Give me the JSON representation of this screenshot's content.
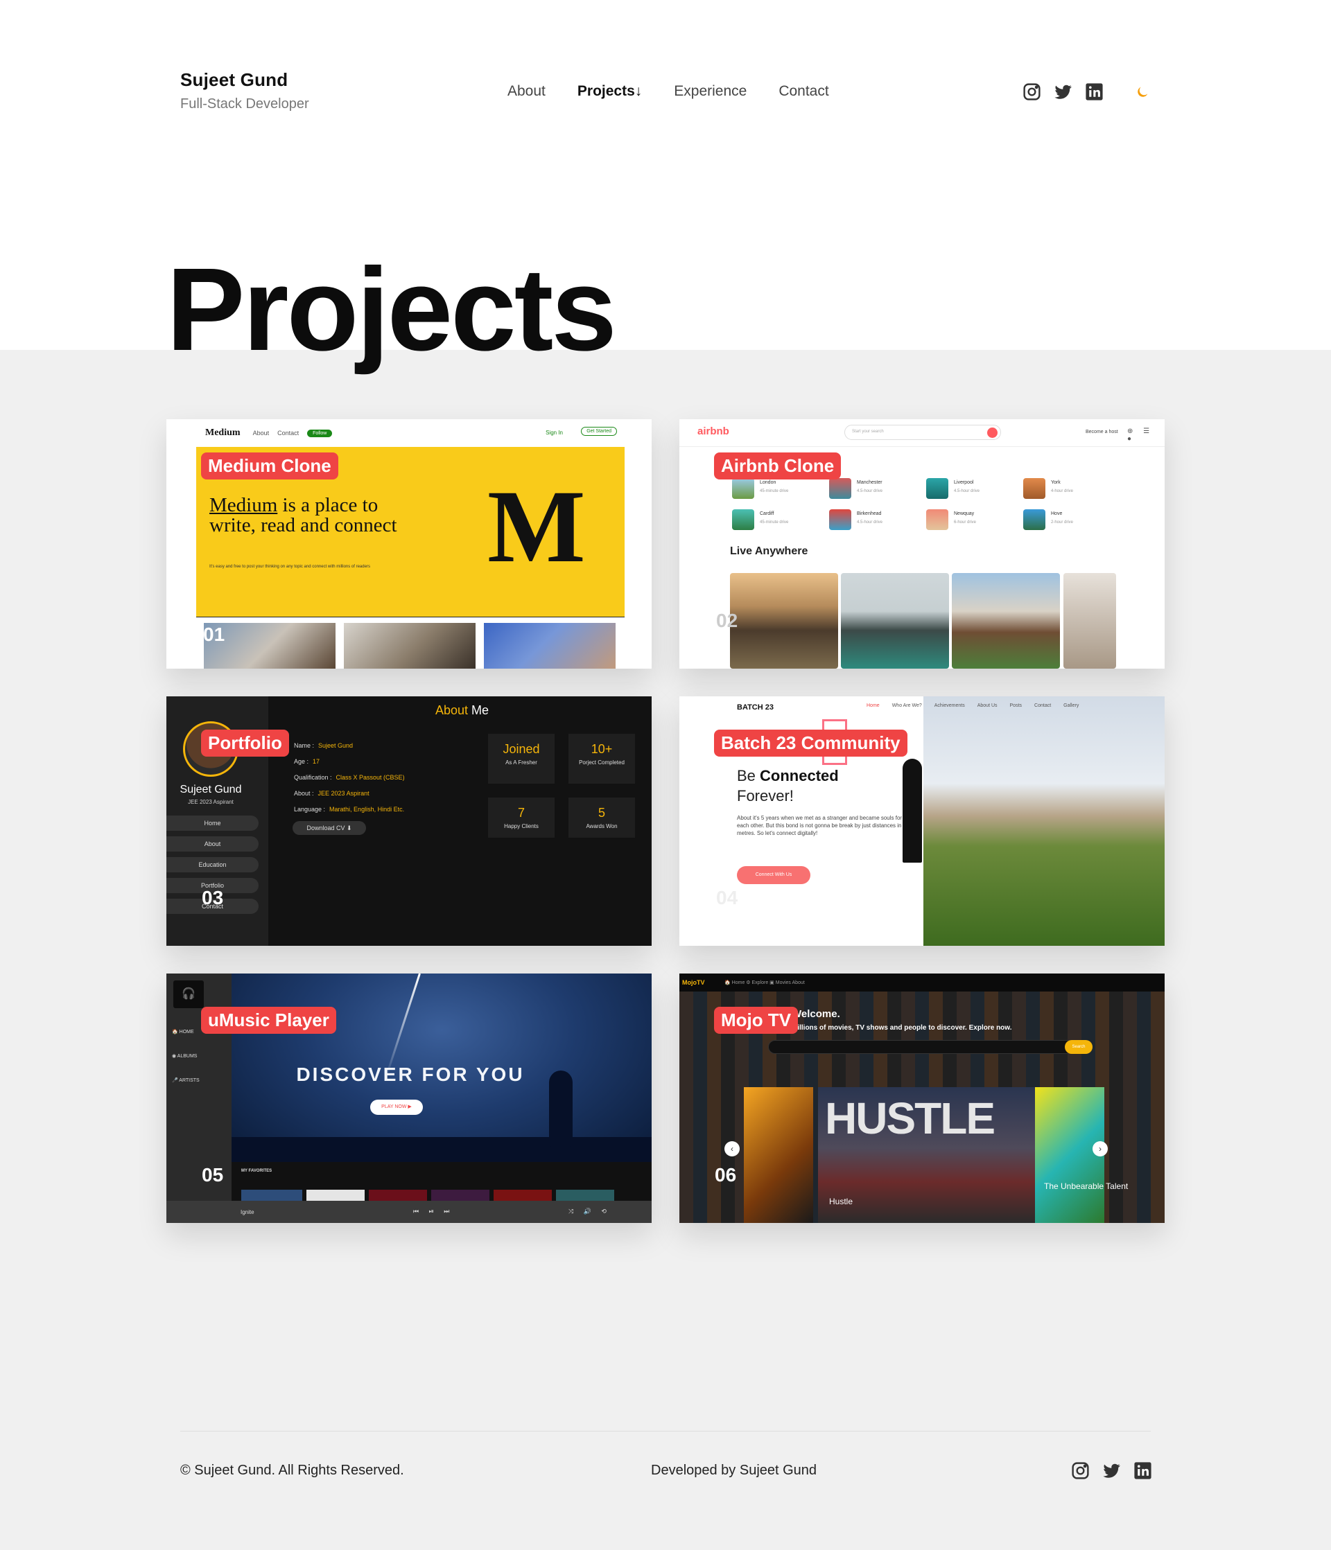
{
  "header": {
    "name": "Sujeet Gund",
    "role": "Full-Stack Developer",
    "nav": [
      {
        "label": "About"
      },
      {
        "label": "Projects↓"
      },
      {
        "label": "Experience"
      },
      {
        "label": "Contact"
      }
    ],
    "social_icons": [
      "instagram-icon",
      "twitter-icon",
      "linkedin-icon"
    ],
    "theme_icon": "moon-icon"
  },
  "page": {
    "title": "Projects"
  },
  "projects": [
    {
      "label": "Medium Clone",
      "number": "01",
      "preview": {
        "nav_logo": "Medium",
        "nav_links": [
          "About",
          "Contact"
        ],
        "follow": "Follow",
        "sign_in": "Sign In",
        "get_started": "Get Started",
        "tagline_link": "Medium",
        "tagline": "is a place to write, read and connect",
        "small": "It's easy and free to post your thinking on any topic and connect with millions of readers",
        "big_letter": "M"
      }
    },
    {
      "label": "Airbnb Clone",
      "number": "02",
      "preview": {
        "logo": "airbnb",
        "search_placeholder": "Start your search",
        "host": "Become a host",
        "icons": "⊕ ☰ ●",
        "locations": [
          {
            "city": "London",
            "drive": "45-minute drive"
          },
          {
            "city": "Manchester",
            "drive": "4.5-hour drive"
          },
          {
            "city": "Liverpool",
            "drive": "4.5-hour drive"
          },
          {
            "city": "York",
            "drive": "4-hour drive"
          },
          {
            "city": "Cardiff",
            "drive": "45-minute drive"
          },
          {
            "city": "Birkenhead",
            "drive": "4.5-hour drive"
          },
          {
            "city": "Newquay",
            "drive": "6-hour drive"
          },
          {
            "city": "Hove",
            "drive": "2-hour drive"
          }
        ],
        "section": "Live Anywhere"
      }
    },
    {
      "label": "Portfolio",
      "number": "03",
      "preview": {
        "name": "Sujeet Gund",
        "role": "JEE 2023 Aspirant",
        "menu": [
          "Home",
          "About",
          "Education",
          "Portfolio",
          "Contact"
        ],
        "heading_a": "About",
        "heading_b": " Me",
        "info": [
          {
            "k": "Name :",
            "v": "Sujeet Gund"
          },
          {
            "k": "Age :",
            "v": "17"
          },
          {
            "k": "Qualification :",
            "v": "Class X Passout (CBSE)"
          },
          {
            "k": "About :",
            "v": "JEE 2023 Aspirant"
          },
          {
            "k": "Language :",
            "v": "Marathi, English, Hindi Etc."
          }
        ],
        "download": "Download CV ⬇",
        "stats": [
          {
            "v": "Joined",
            "t": "As A Fresher"
          },
          {
            "v": "10+",
            "t": "Porject Completed"
          },
          {
            "v": "7",
            "t": "Happy Clients"
          },
          {
            "v": "5",
            "t": "Awards Won"
          }
        ]
      }
    },
    {
      "label": "Batch 23 Community",
      "number": "04",
      "preview": {
        "title": "BATCH 23",
        "nav": [
          "Home",
          "Who Are We?",
          "Achievements",
          "About Us",
          "Posts",
          "Contact",
          "Gallery"
        ],
        "be": "Be ",
        "connected": "Connected",
        "forever": "Forever!",
        "text": "About it's 5 years when we met as a stranger and became souls for each other. But this bond is not gonna be break by just distances in metres. So let's connect digitally!",
        "button": "Connect With Us"
      }
    },
    {
      "label": "uMusic Player",
      "number": "05",
      "preview": {
        "menu": [
          "🏠  HOME",
          "◉  ALBUMS",
          "🎤  ARTISTS"
        ],
        "hero": "DISCOVER FOR YOU",
        "play": "PLAY NOW ▶",
        "favorites": "MY FAVORITES",
        "track": "Ignite",
        "controls": "⏮ ⏯ ⏭",
        "right_controls": "⤨ 🔊 ⟲"
      }
    },
    {
      "label": "Mojo TV",
      "number": "06",
      "preview": {
        "logo": "MojoTV",
        "links": "🏠 Home  ⚙ Explore  ▣ Movies  About",
        "welcome": "Welcome.",
        "sub": "Millions of movies, TV shows and people to discover. Explore now.",
        "search": "Search",
        "feature": "HUSTLE",
        "feature_title": "Hustle",
        "side_title": "The Unbearable Talent",
        "prev": "‹",
        "next": "›"
      }
    }
  ],
  "footer": {
    "copyright": "© Sujeet Gund. All Rights Reserved.",
    "developed": "Developed by  Sujeet Gund",
    "social_icons": [
      "instagram-icon",
      "twitter-icon",
      "linkedin-icon"
    ]
  },
  "colors": {
    "accent_label": "#ef4444",
    "moon": "#f59e0b",
    "portfolio_gold": "#f5b50a",
    "medium_yellow": "#f9cb1a"
  }
}
